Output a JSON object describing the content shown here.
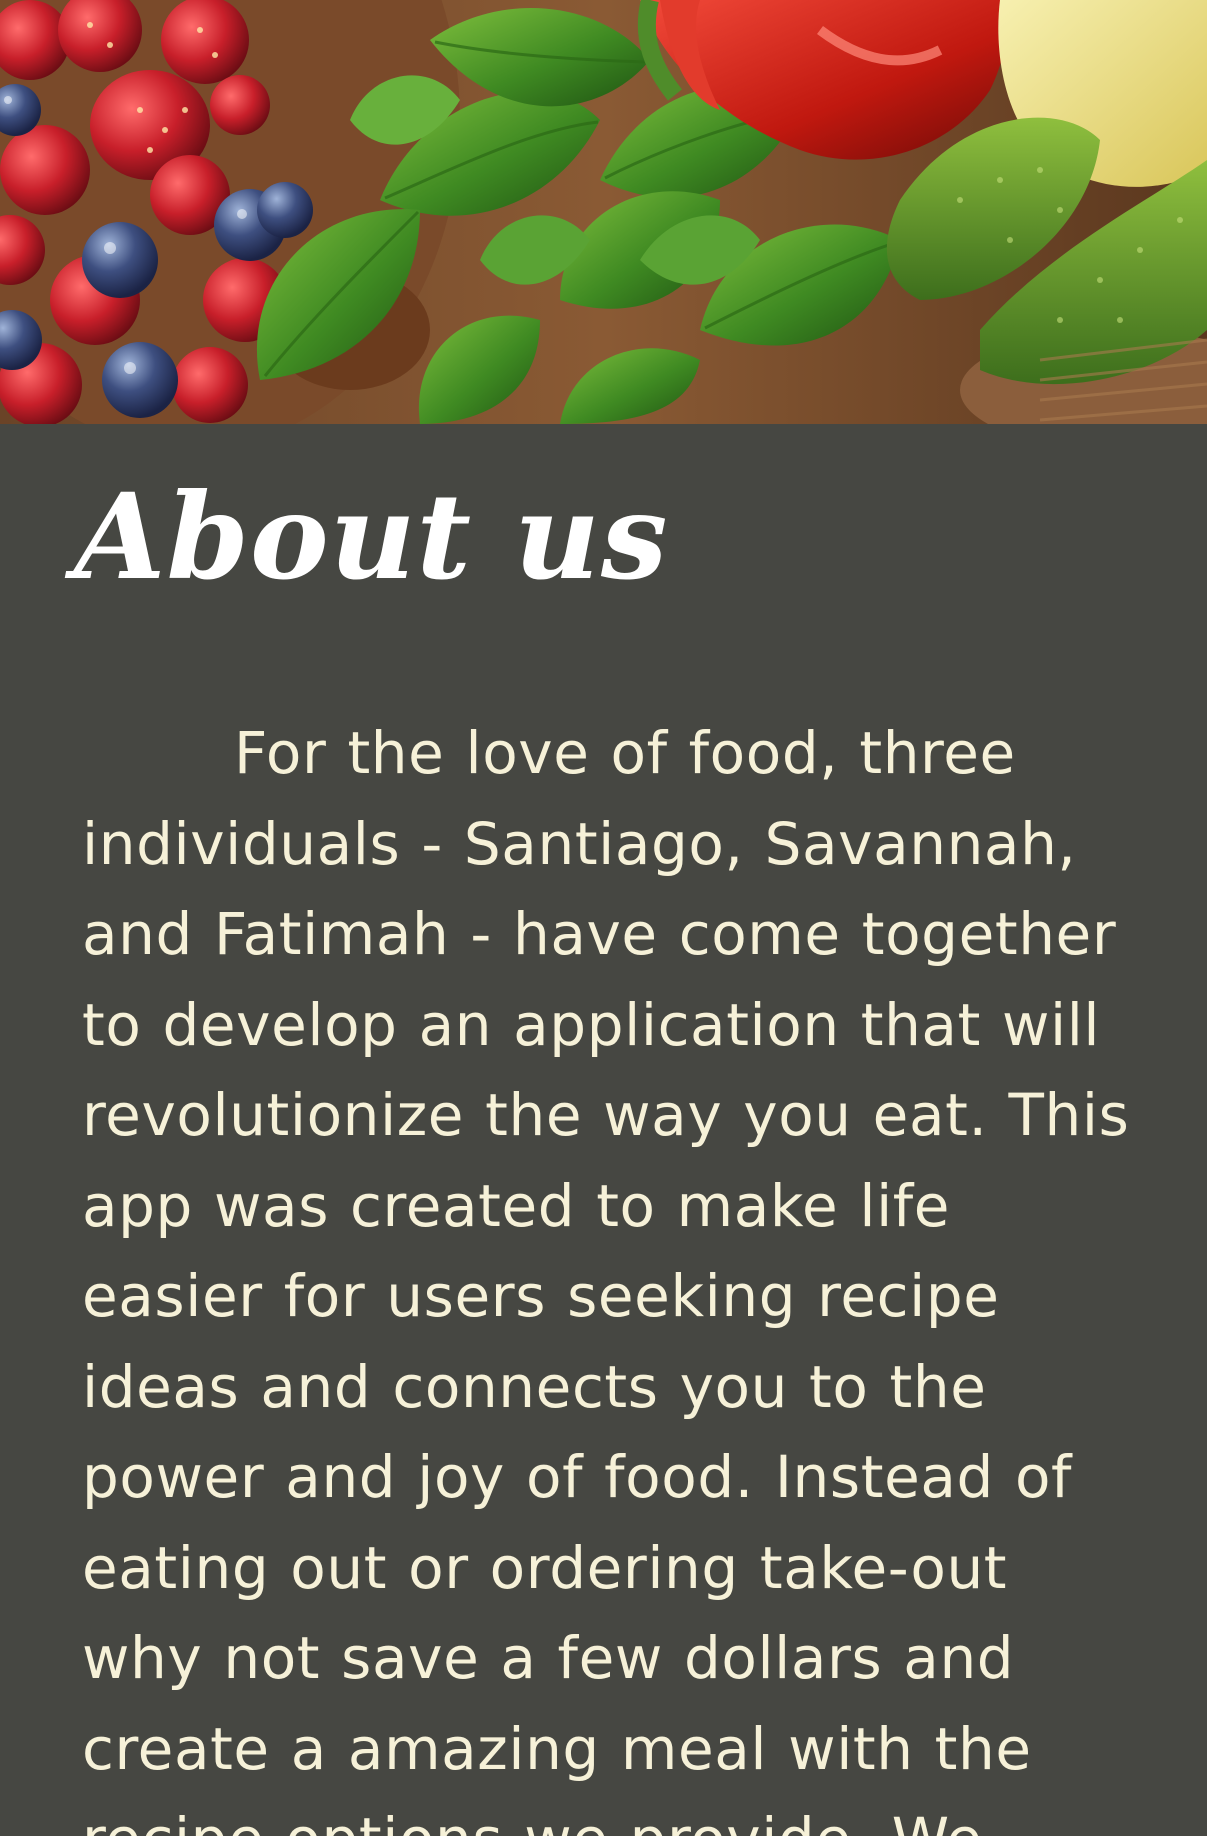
{
  "hero": {
    "image_description_icon": "fresh-produce-banner-image"
  },
  "about": {
    "title": "About us",
    "body": "For the love of food, three individuals - Santiago, Savannah, and Fatimah - have come together to develop an application that will revolutionize the way you eat. This app was created to make life easier for users seeking recipe ideas and connects you to the power and joy of food. Instead of eating out or ordering take-out why not save a few dollars and create a amazing meal with the recipe options we provide. We"
  },
  "colors": {
    "background": "#464742",
    "title_text": "#ffffff",
    "body_text": "#f6f1d8"
  }
}
